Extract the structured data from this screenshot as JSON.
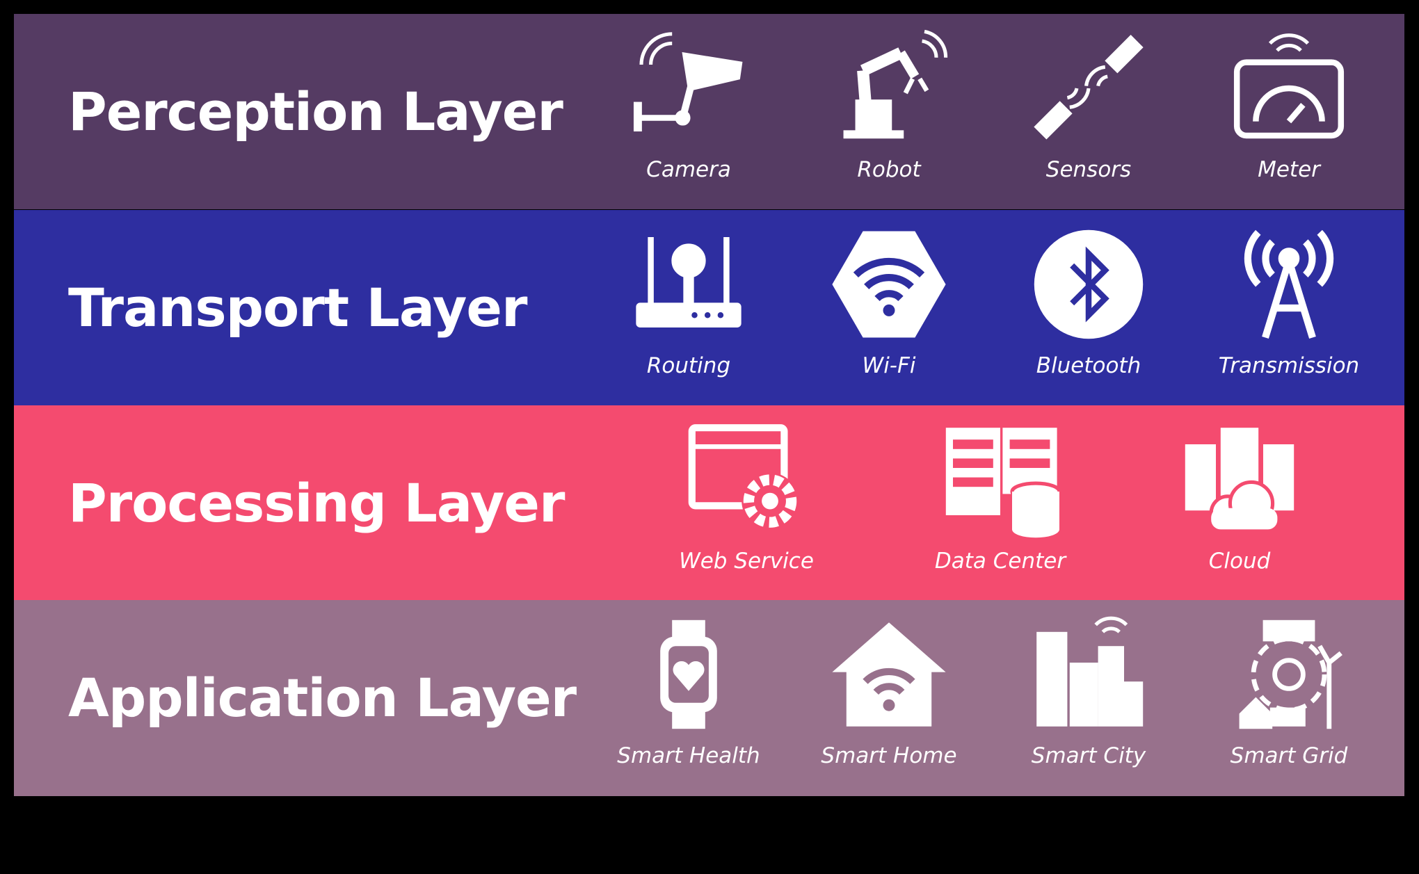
{
  "colors": {
    "perception": "#553b63",
    "transport": "#2e2ea0",
    "processing": "#f44b6f",
    "application": "#98718c",
    "background": "#000000"
  },
  "layers": [
    {
      "title": "Perception Layer",
      "items": [
        {
          "label": "Camera",
          "icon": "security-camera-icon"
        },
        {
          "label": "Robot",
          "icon": "robot-arm-icon"
        },
        {
          "label": "Sensors",
          "icon": "sensors-icon"
        },
        {
          "label": "Meter",
          "icon": "meter-icon"
        }
      ]
    },
    {
      "title": "Transport Layer",
      "items": [
        {
          "label": "Routing",
          "icon": "router-icon"
        },
        {
          "label": "Wi-Fi",
          "icon": "wifi-icon"
        },
        {
          "label": "Bluetooth",
          "icon": "bluetooth-icon"
        },
        {
          "label": "Transmission",
          "icon": "transmission-tower-icon"
        }
      ]
    },
    {
      "title": "Processing Layer",
      "items": [
        {
          "label": "Web Service",
          "icon": "web-service-gear-icon"
        },
        {
          "label": "Data Center",
          "icon": "data-center-icon"
        },
        {
          "label": "Cloud",
          "icon": "cloud-server-icon"
        }
      ]
    },
    {
      "title": "Application Layer",
      "items": [
        {
          "label": "Smart Health",
          "icon": "smartwatch-icon"
        },
        {
          "label": "Smart Home",
          "icon": "smart-home-icon"
        },
        {
          "label": "Smart City",
          "icon": "smart-city-icon"
        },
        {
          "label": "Smart Grid",
          "icon": "smart-grid-icon"
        }
      ]
    }
  ]
}
